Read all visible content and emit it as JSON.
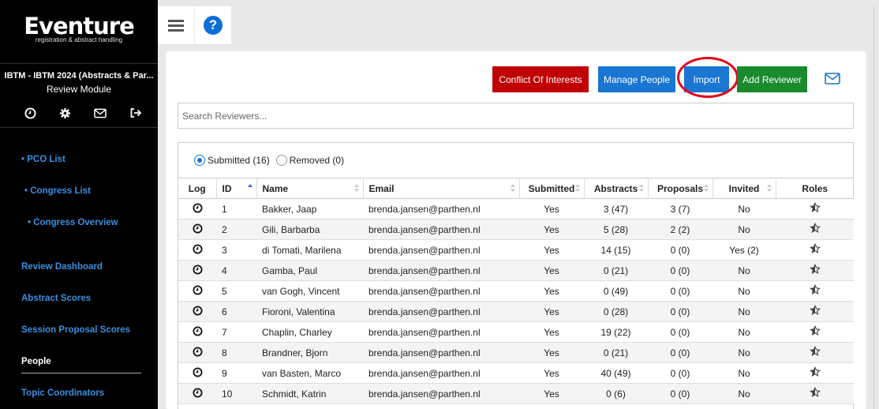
{
  "app": {
    "logo": "Eventure",
    "logo_tagline": "registration & abstract handling"
  },
  "event": {
    "title": "IBTM - IBTM 2024 (Abstracts & Par...",
    "module": "Review Module"
  },
  "sidebar": {
    "icons": [
      "clock-icon",
      "gear-icon",
      "mail-icon",
      "logout-icon"
    ],
    "items": [
      {
        "label": "• PCO List"
      },
      {
        "label": "• Congress List"
      },
      {
        "label": "• Congress Overview"
      },
      {
        "label": "Review Dashboard"
      },
      {
        "label": "Abstract Scores"
      },
      {
        "label": "Session Proposal Scores"
      },
      {
        "label": "People"
      },
      {
        "label": "Topic Coordinators"
      }
    ]
  },
  "toolbar": {
    "conflict_label": "Conflict Of Interests",
    "manage_label": "Manage People",
    "import_label": "Import",
    "add_label": "Add Reviewer"
  },
  "search": {
    "placeholder": "Search Reviewers..."
  },
  "filters": {
    "submitted": "Submitted (16)",
    "removed": "Removed (0)"
  },
  "table": {
    "headers": [
      "Log",
      "ID",
      "Name",
      "Email",
      "Submitted",
      "Abstracts",
      "Proposals",
      "Invited",
      "Roles"
    ],
    "rows": [
      {
        "id": "1",
        "name": "Bakker, Jaap",
        "email": "brenda.jansen@parthen.nl",
        "submitted": "Yes",
        "abstracts": "3 (47)",
        "proposals": "3 (7)",
        "invited": "No"
      },
      {
        "id": "2",
        "name": "Gili, Barbarba",
        "email": "brenda.jansen@parthen.nl",
        "submitted": "Yes",
        "abstracts": "5 (28)",
        "proposals": "2 (2)",
        "invited": "No"
      },
      {
        "id": "3",
        "name": "di Tomati, Marilena",
        "email": "brenda.jansen@parthen.nl",
        "submitted": "Yes",
        "abstracts": "14 (15)",
        "proposals": "0 (0)",
        "invited": "Yes (2)"
      },
      {
        "id": "4",
        "name": "Gamba, Paul",
        "email": "brenda.jansen@parthen.nl",
        "submitted": "Yes",
        "abstracts": "0 (21)",
        "proposals": "0 (0)",
        "invited": "No"
      },
      {
        "id": "5",
        "name": "van Gogh, Vincent",
        "email": "brenda.jansen@parthen.nl",
        "submitted": "Yes",
        "abstracts": "0 (49)",
        "proposals": "0 (0)",
        "invited": "No"
      },
      {
        "id": "6",
        "name": "Fioroni, Valentina",
        "email": "brenda.jansen@parthen.nl",
        "submitted": "Yes",
        "abstracts": "0 (28)",
        "proposals": "0 (0)",
        "invited": "No"
      },
      {
        "id": "7",
        "name": "Chaplin, Charley",
        "email": "brenda.jansen@parthen.nl",
        "submitted": "Yes",
        "abstracts": "19 (22)",
        "proposals": "0 (0)",
        "invited": "No"
      },
      {
        "id": "8",
        "name": "Brandner, Bjorn",
        "email": "brenda.jansen@parthen.nl",
        "submitted": "Yes",
        "abstracts": "0 (21)",
        "proposals": "0 (0)",
        "invited": "No"
      },
      {
        "id": "9",
        "name": "van Basten, Marco",
        "email": "brenda.jansen@parthen.nl",
        "submitted": "Yes",
        "abstracts": "40 (49)",
        "proposals": "0 (0)",
        "invited": "No"
      },
      {
        "id": "10",
        "name": "Schmidt, Katrin",
        "email": "brenda.jansen@parthen.nl",
        "submitted": "Yes",
        "abstracts": "0 (6)",
        "proposals": "0 (0)",
        "invited": "No"
      }
    ]
  },
  "colors": {
    "accent": "#1976d2",
    "danger": "#c00000",
    "success": "#1a8a2e",
    "highlight": "#e0001b"
  }
}
